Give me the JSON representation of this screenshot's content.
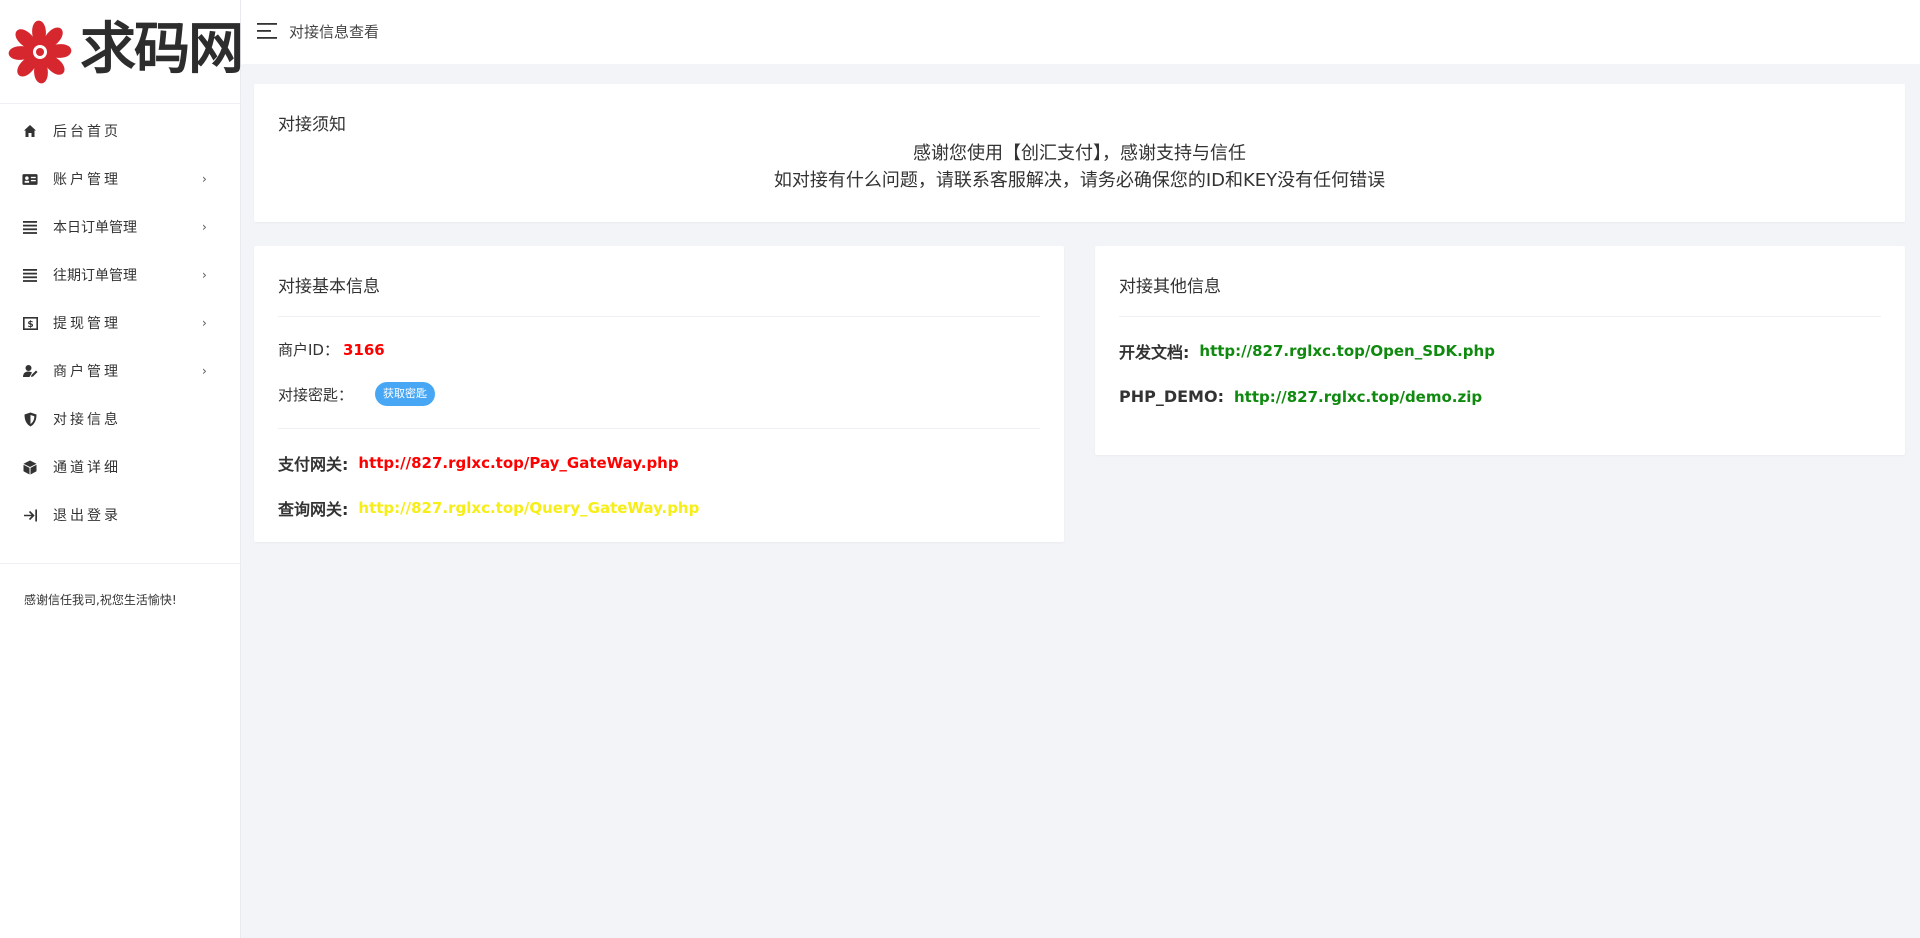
{
  "brand": {
    "logo_text": "求码网",
    "logo_color": "#d6262e"
  },
  "topbar": {
    "menu_icon": "hamburger-icon",
    "title": "对接信息查看"
  },
  "sidebar": {
    "items": [
      {
        "label": "后台首页",
        "icon": "home-icon",
        "has_submenu": false
      },
      {
        "label": "账户管理",
        "icon": "id-card-icon",
        "has_submenu": true
      },
      {
        "label": "本日订单管理",
        "icon": "list-icon",
        "has_submenu": true
      },
      {
        "label": "往期订单管理",
        "icon": "list-icon",
        "has_submenu": true
      },
      {
        "label": "提现管理",
        "icon": "money-icon",
        "has_submenu": true
      },
      {
        "label": "商户管理",
        "icon": "user-edit-icon",
        "has_submenu": true
      },
      {
        "label": "对接信息",
        "icon": "shield-icon",
        "has_submenu": false
      },
      {
        "label": "通道详细",
        "icon": "cube-icon",
        "has_submenu": false
      },
      {
        "label": "退出登录",
        "icon": "logout-icon",
        "has_submenu": false
      }
    ],
    "chevron": "›",
    "footer_text": "感谢信任我司,祝您生活愉快!"
  },
  "notice": {
    "title": "对接须知",
    "line1": "感谢您使用【创汇支付】，感谢支持与信任",
    "line2": "如对接有什么问题，请联系客服解决，请务必确保您的ID和KEY没有任何错误"
  },
  "basic_info": {
    "title": "对接基本信息",
    "merchant_id_label": "商户ID：",
    "merchant_id_value": "3166",
    "key_label": "对接密匙：",
    "key_button": "获取密匙",
    "pay_gateway_label": "支付网关:",
    "pay_gateway_url": "http://827.rglxc.top/Pay_GateWay.php",
    "query_gateway_label": "查询网关:",
    "query_gateway_url": "http://827.rglxc.top/Query_GateWay.php"
  },
  "other_info": {
    "title": "对接其他信息",
    "docs_label": "开发文档:",
    "docs_url": "http://827.rglxc.top/Open_SDK.php",
    "demo_label": "PHP_DEMO:",
    "demo_url": "http://827.rglxc.top/demo.zip"
  },
  "colors": {
    "accent_blue": "#47a7f4",
    "link_red": "#ff0000",
    "link_yellow": "#f6ee16",
    "link_green": "#0f8a0f",
    "background": "#f3f4f8"
  }
}
